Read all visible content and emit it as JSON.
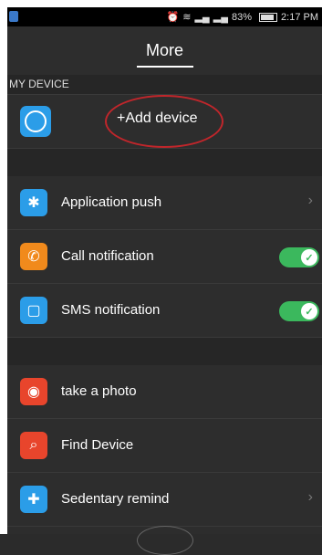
{
  "status": {
    "battery_text": "83%",
    "time": "2:17 PM",
    "icons": [
      "alarm-icon",
      "wifi-icon",
      "signal-icon",
      "signal-icon",
      "battery-icon"
    ]
  },
  "header": {
    "title": "More"
  },
  "my_device": {
    "section_label": "MY DEVICE",
    "add_label": "+Add device",
    "icon": "link-icon",
    "icon_color": "#2b9de8"
  },
  "items": [
    {
      "label": "Application push",
      "icon": "gear-badge-icon",
      "icon_color": "#2b9de8",
      "control": "chevron"
    },
    {
      "label": "Call notification",
      "icon": "phone-icon",
      "icon_color": "#f18a1c",
      "control": "toggle",
      "on": true
    },
    {
      "label": "SMS notification",
      "icon": "message-icon",
      "icon_color": "#2b9de8",
      "control": "toggle",
      "on": true
    }
  ],
  "items2": [
    {
      "label": "take a photo",
      "icon": "camera-icon",
      "icon_color": "#e8452c",
      "control": "none"
    },
    {
      "label": "Find Device",
      "icon": "search-icon",
      "icon_color": "#e8452c",
      "control": "none"
    },
    {
      "label": "Sedentary remind",
      "icon": "seat-icon",
      "icon_color": "#2b9de8",
      "control": "chevron"
    }
  ],
  "chevron_glyph": "›",
  "toggle_colors": {
    "on": "#3bb85d"
  }
}
